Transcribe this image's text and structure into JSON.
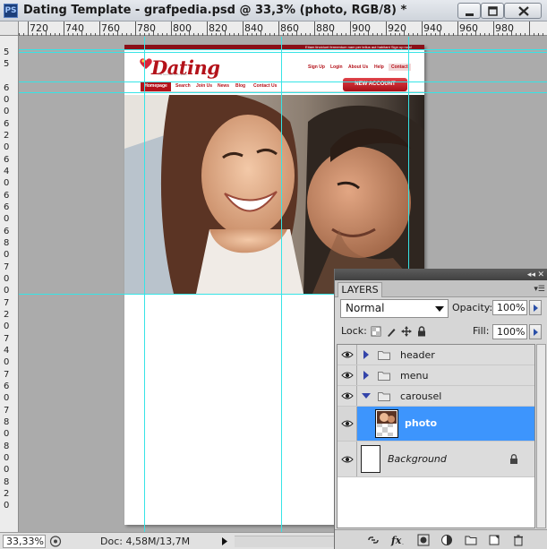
{
  "window": {
    "app_icon": "PS",
    "title": "Dating Template - grafpedia.psd @ 33,3% (photo, RGB/8) *",
    "controls": [
      "minimize-icon",
      "maximize-icon",
      "close-icon"
    ]
  },
  "ruler": {
    "top_labels": [
      "720",
      "740",
      "760",
      "780",
      "800",
      "820",
      "840",
      "860",
      "880",
      "900",
      "920",
      "940",
      "960",
      "980"
    ],
    "left_labels": [
      "5",
      "5",
      "6",
      "0",
      "0",
      "6",
      "2",
      "0",
      "6",
      "4",
      "0",
      "6",
      "6",
      "0",
      "6",
      "8",
      "0",
      "7",
      "0",
      "0",
      "7",
      "2",
      "0",
      "7",
      "4",
      "0",
      "7",
      "6",
      "0",
      "7",
      "8",
      "0",
      "8",
      "0",
      "0",
      "8",
      "2",
      "0"
    ]
  },
  "document": {
    "top_strip_text": "Etiam tincidunt fermentum nam per tellus aut habitant   Sign up now!",
    "logo_text": "Dating",
    "logo_tagline": "the best dating template",
    "top_nav": [
      "Sign Up",
      "Login",
      "About Us",
      "Help",
      "Contact"
    ],
    "main_nav": [
      "Homepage",
      "Search",
      "Join Us",
      "News",
      "Blog",
      "Contact Us"
    ],
    "cta": "NEW ACCOUNT",
    "colors": {
      "brand_red": "#b4121a",
      "guide_cyan": "#36e4e6"
    }
  },
  "status": {
    "zoom": "33,33%",
    "doc_size": "Doc: 4,58M/13,7M"
  },
  "layers_panel": {
    "tab": "LAYERS",
    "blend_mode": "Normal",
    "opacity_label": "Opacity:",
    "opacity": "100%",
    "lock_label": "Lock:",
    "fill_label": "Fill:",
    "fill": "100%",
    "layers": [
      {
        "name": "header",
        "type": "group",
        "expanded": false,
        "visible": true
      },
      {
        "name": "menu",
        "type": "group",
        "expanded": false,
        "visible": true
      },
      {
        "name": "carousel",
        "type": "group",
        "expanded": true,
        "visible": true
      },
      {
        "name": "photo",
        "type": "layer",
        "selected": true,
        "visible": true
      },
      {
        "name": "Background",
        "type": "background",
        "locked": true,
        "visible": true
      }
    ],
    "bottom_icons": [
      "link-icon",
      "fx-icon",
      "mask-icon",
      "adjustment-icon",
      "group-icon",
      "new-layer-icon",
      "trash-icon"
    ]
  }
}
